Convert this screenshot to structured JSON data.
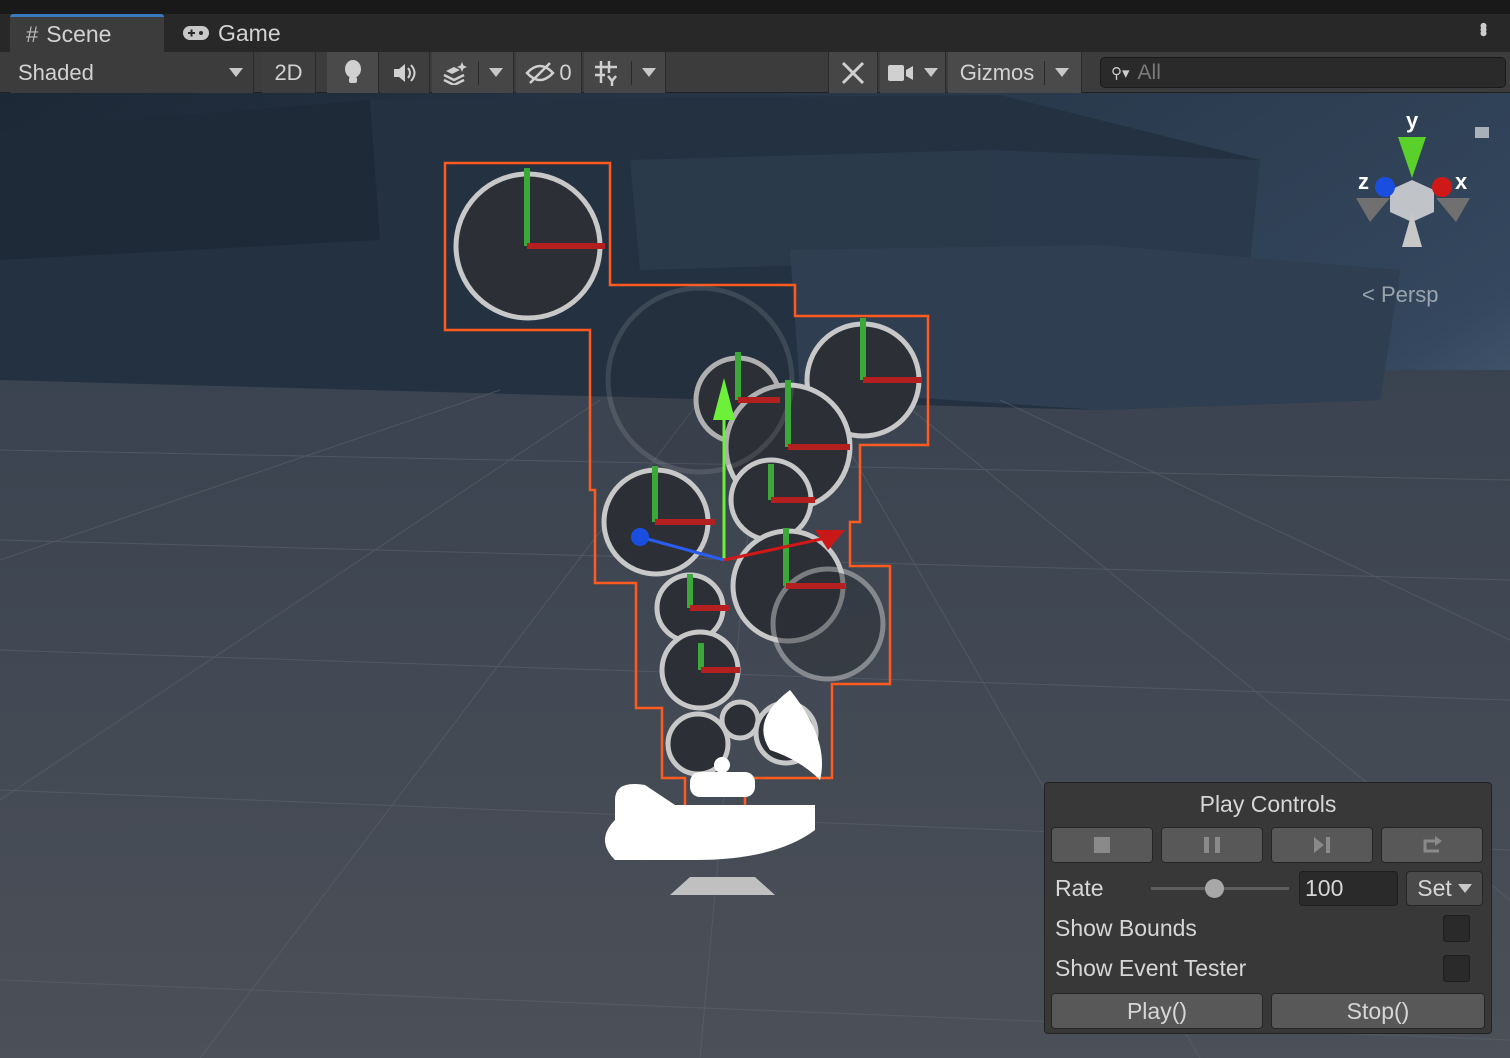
{
  "tabs": [
    {
      "label": "Scene",
      "icon": "grid-hash-icon",
      "active": true
    },
    {
      "label": "Game",
      "icon": "gamepad-icon",
      "active": false
    }
  ],
  "toolbar": {
    "shading_mode": "Shaded",
    "mode_2d": "2D",
    "hidden_count": "0",
    "gizmos_label": "Gizmos",
    "search_placeholder": "All"
  },
  "orientation_gizmo": {
    "y": "y",
    "x": "x",
    "z": "z",
    "projection": "Persp"
  },
  "play_controls": {
    "title": "Play Controls",
    "rate_label": "Rate",
    "rate_value": "100",
    "rate_slider_fraction": 0.46,
    "set_label": "Set",
    "show_bounds_label": "Show Bounds",
    "show_bounds_checked": false,
    "show_event_tester_label": "Show Event Tester",
    "show_event_tester_checked": false,
    "play_label": "Play()",
    "stop_label": "Stop()"
  },
  "colors": {
    "selection": "#ff5a1f",
    "accent": "#3a79bb",
    "x_axis": "#d01818",
    "y_axis": "#5ad02a",
    "z_axis": "#1a4ee0"
  }
}
